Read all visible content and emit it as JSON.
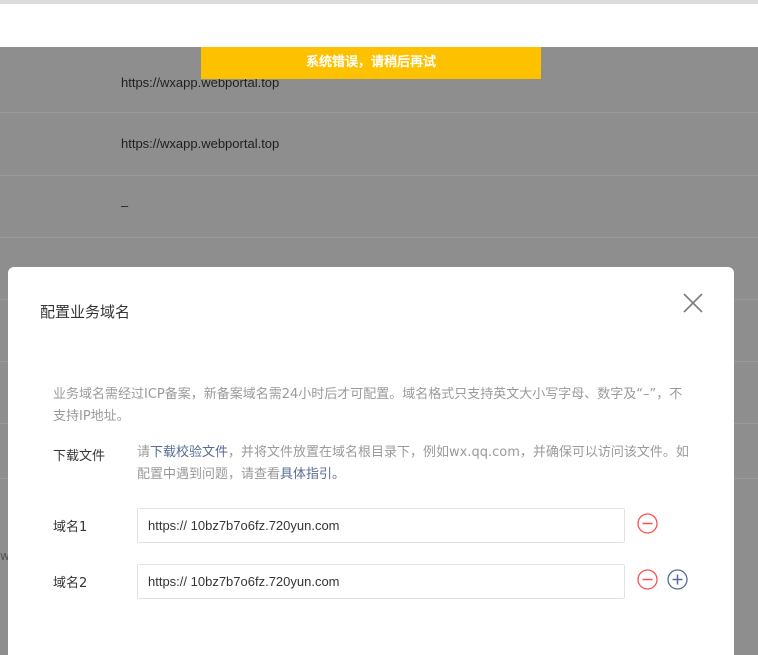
{
  "toast": {
    "message": "系统错误，请稍后再试"
  },
  "background": {
    "rows": [
      "https://wxapp.webportal.top",
      "https://wxapp.webportal.top",
      "–"
    ],
    "edge_char": "w"
  },
  "dialog": {
    "title": "配置业务域名",
    "notice": "业务域名需经过ICP备案，新备案域名需24小时后才可配置。域名格式只支持英文大小写字母、数字及“–”，不支持IP地址。",
    "download": {
      "label": "下载文件",
      "prefix": "请",
      "link_text": "下载校验文件",
      "middle": "，并将文件放置在域名根目录下，例如wx.qq.com，并确保可以访问该文件。如配置中遇到问题，请查看",
      "guide_link": "具体指引",
      "suffix": "。"
    },
    "domains": [
      {
        "label": "域名1",
        "value": "https:// 10bz7b7o6fz.720yun.com"
      },
      {
        "label": "域名2",
        "value": "https:// 10bz7b7o6fz.720yun.com"
      }
    ]
  },
  "colors": {
    "toast_bg": "#fec100",
    "remove_icon": "#fa5151",
    "add_icon": "#576b95",
    "link": "#576b95"
  },
  "icons": {
    "close": "close-icon",
    "remove": "minus-circle-icon",
    "add": "plus-circle-icon"
  }
}
